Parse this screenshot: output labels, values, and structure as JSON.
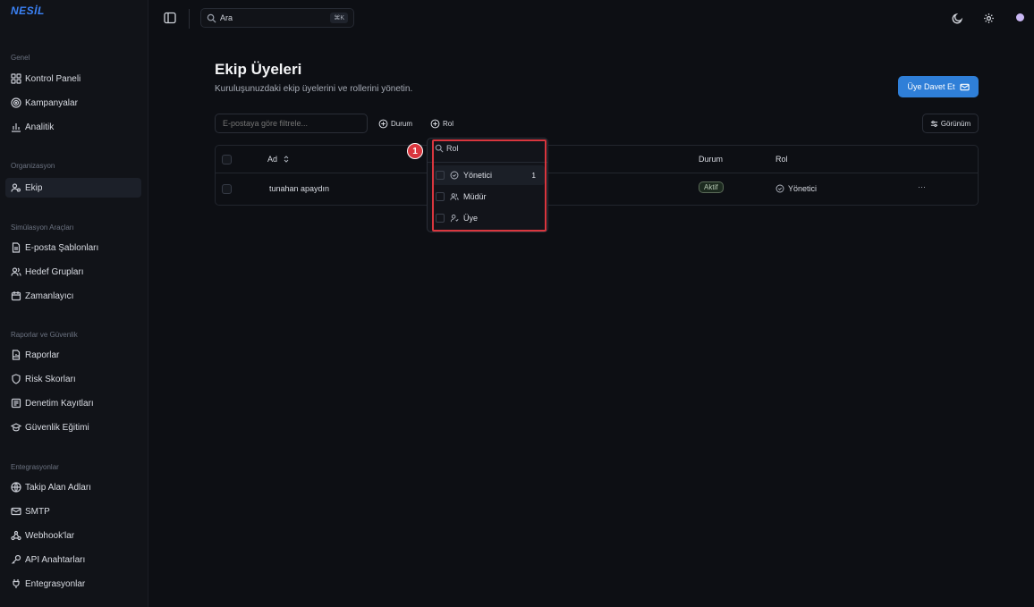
{
  "app": {
    "logo": "NESİL"
  },
  "topbar": {
    "search_placeholder": "Ara",
    "search_shortcut": "⌘K"
  },
  "sidebar": {
    "sections": [
      {
        "title": "Genel",
        "items": [
          {
            "label": "Kontrol Paneli",
            "icon": "dashboard-icon"
          },
          {
            "label": "Kampanyalar",
            "icon": "target-icon"
          },
          {
            "label": "Analitik",
            "icon": "bar-chart-icon"
          }
        ]
      },
      {
        "title": "Organizasyon",
        "items": [
          {
            "label": "Ekip",
            "icon": "team-icon",
            "active": true
          }
        ]
      },
      {
        "title": "Simülasyon Araçları",
        "items": [
          {
            "label": "E-posta Şablonları",
            "icon": "document-icon"
          },
          {
            "label": "Hedef Grupları",
            "icon": "users-icon"
          },
          {
            "label": "Zamanlayıcı",
            "icon": "calendar-icon"
          }
        ]
      },
      {
        "title": "Raporlar ve Güvenlik",
        "items": [
          {
            "label": "Raporlar",
            "icon": "report-icon"
          },
          {
            "label": "Risk Skorları",
            "icon": "shield-icon"
          },
          {
            "label": "Denetim Kayıtları",
            "icon": "logs-icon"
          },
          {
            "label": "Güvenlik Eğitimi",
            "icon": "graduation-cap-icon"
          }
        ]
      },
      {
        "title": "Entegrasyonlar",
        "items": [
          {
            "label": "Takip Alan Adları",
            "icon": "globe-icon"
          },
          {
            "label": "SMTP",
            "icon": "mail-icon"
          },
          {
            "label": "Webhook'lar",
            "icon": "webhook-icon"
          },
          {
            "label": "API Anahtarları",
            "icon": "key-icon"
          },
          {
            "label": "Entegrasyonlar",
            "icon": "plug-icon"
          }
        ]
      }
    ]
  },
  "main": {
    "title": "Ekip Üyeleri",
    "subtitle": "Kuruluşunuzdaki ekip üyelerini ve rollerini yönetin.",
    "invite_button": "Üye Davet Et",
    "filter_placeholder": "E-postaya göre filtrele...",
    "facet_status": "Durum",
    "facet_role": "Rol",
    "view_button": "Görünüm",
    "table": {
      "columns": {
        "name": "Ad",
        "status": "Durum",
        "role": "Rol"
      },
      "rows": [
        {
          "name": "tunahan apaydın",
          "status": "Aktif",
          "role": "Yönetici",
          "actions": "···"
        }
      ]
    }
  },
  "role_dropdown": {
    "search_value": "Rol",
    "options": [
      {
        "label": "Yönetici",
        "count": "1",
        "icon": "shield-check-icon"
      },
      {
        "label": "Müdür",
        "icon": "users-icon"
      },
      {
        "label": "Üye",
        "icon": "user-icon"
      }
    ]
  },
  "annotation": {
    "step": "1",
    "color": "#d9363e"
  },
  "colors": {
    "accent": "#2f7fd8",
    "background": "#0d0f14",
    "sidebar": "#111318"
  }
}
